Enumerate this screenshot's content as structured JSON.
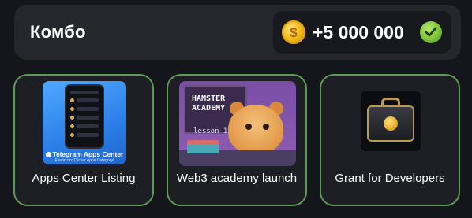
{
  "combo": {
    "title": "Комбо",
    "reward_amount": "+5 000 000",
    "coin_icon": "coin-dollar-icon",
    "status_icon": "check-circle-icon",
    "colors": {
      "panel_bg": "#25272d",
      "pill_bg": "#17191e",
      "coin": "#f5bd1c",
      "check": "#7cc23a"
    }
  },
  "cards": [
    {
      "label": "Apps Center Listing",
      "image": {
        "caption": "Telegram Apps Center",
        "subcaption": "Found on: Clicker Apps Category!"
      }
    },
    {
      "label": "Web3 academy launch",
      "image": {
        "title_line1": "HAMSTER",
        "title_line2": "ACADEMY",
        "lesson": "lesson 1"
      }
    },
    {
      "label": "Grant for Developers"
    }
  ],
  "card_border_color": "#5d9a55"
}
